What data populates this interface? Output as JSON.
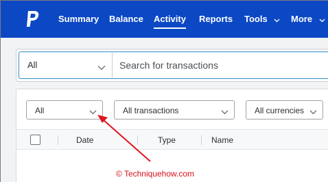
{
  "nav": {
    "logo": "paypal-logo-icon",
    "items": [
      {
        "label": "Summary",
        "active": false
      },
      {
        "label": "Balance",
        "active": false
      },
      {
        "label": "Activity",
        "active": true
      },
      {
        "label": "Reports",
        "active": false
      },
      {
        "label": "Tools",
        "active": false,
        "dropdown": true
      },
      {
        "label": "More",
        "active": false,
        "dropdown": true
      }
    ]
  },
  "search": {
    "scope_value": "All",
    "placeholder": "Search for transactions"
  },
  "filters": {
    "date_range": "All",
    "transaction_type": "All transactions",
    "currency": "All currencies"
  },
  "table": {
    "columns": [
      "Date",
      "Type",
      "Name"
    ]
  },
  "annotation": {
    "arrow_color": "#e0141e",
    "watermark": "© Techniquehow.com"
  },
  "colors": {
    "nav_bg": "#0c48c4",
    "focus_border": "#2f8ec4",
    "page_bg": "#f2f3f5"
  }
}
